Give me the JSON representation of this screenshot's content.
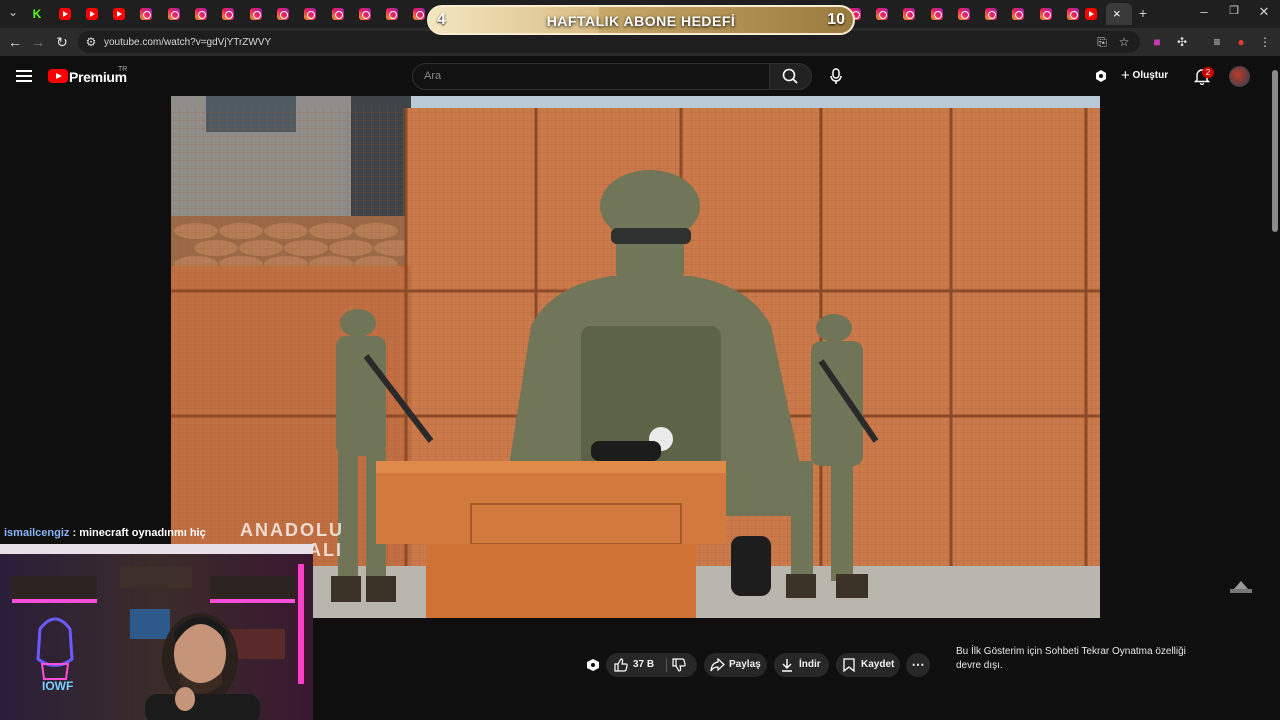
{
  "browser": {
    "url": "youtube.com/watch?v=gdVjYTrZWVY",
    "new_tab_symbol": "+",
    "close_tab_symbol": "×"
  },
  "overlay": {
    "goal_title": "HAFTALIK ABONE HEDEFİ",
    "goal_current": "4",
    "goal_target": "10"
  },
  "youtube": {
    "brand": "Premium",
    "region": "TR",
    "search_placeholder": "Ara",
    "create_label": "Oluştur",
    "notification_count": "2",
    "accent": "#ff0000"
  },
  "video": {
    "watermark_line1": "ANADOLU",
    "watermark_line2": "ALI"
  },
  "chat_overlay": {
    "user": "ismailcengiz",
    "separator": " : ",
    "message": "minecraft oynadınmı hiç"
  },
  "webcam": {
    "neon_sign": "IOWF"
  },
  "actions": {
    "like_count": "37 B",
    "share_label": "Paylaş",
    "download_label": "İndir",
    "save_label": "Kaydet",
    "more_symbol": "⋯"
  },
  "chat_notice": "Bu İlk Gösterim için Sohbeti Tekrar Oynatma özelliği devre dışı."
}
